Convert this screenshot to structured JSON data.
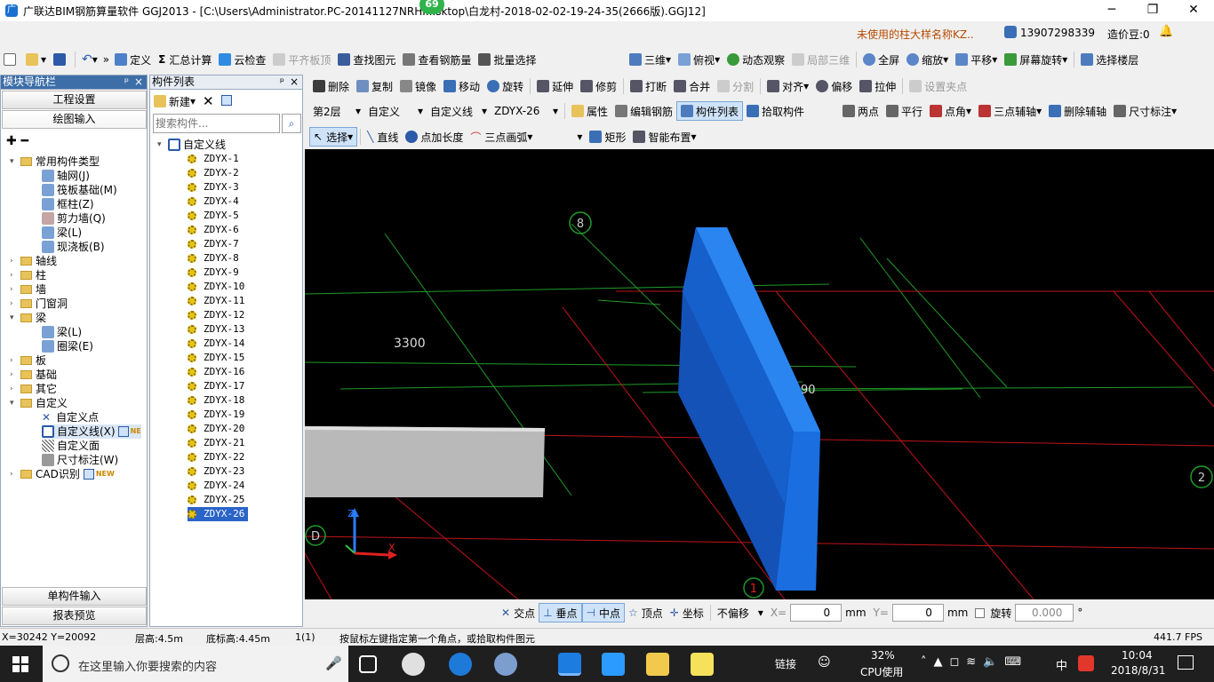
{
  "window": {
    "badge": "69",
    "title": "广联达BIM钢筋算量软件 GGJ2013 - [C:\\Users\\Administrator.PC-20141127NRHI...sktop\\白龙村-2018-02-02-19-24-35(2666版).GGJ12]",
    "min": "─",
    "max": "❐",
    "close": "✕"
  },
  "info_bar": {
    "notice": "未使用的柱大样名称KZ..",
    "phone": "13907298339",
    "beans": "造价豆:0"
  },
  "toolbar1": {
    "items": [
      "定义",
      "汇总计算",
      "云检查",
      "平齐板顶",
      "查找图元",
      "查看钢筋量",
      "批量选择",
      "三维",
      "俯视",
      "动态观察",
      "局部三维",
      "全屏",
      "缩放",
      "平移",
      "屏幕旋转",
      "选择楼层"
    ]
  },
  "toolbar2": {
    "items": [
      "删除",
      "复制",
      "镜像",
      "移动",
      "旋转",
      "延伸",
      "修剪",
      "打断",
      "合并",
      "分割",
      "对齐",
      "偏移",
      "拉伸",
      "设置夹点"
    ]
  },
  "toolbar3": {
    "floor": "第2层",
    "type": "自定义",
    "subtype": "自定义线",
    "component": "ZDYX-26",
    "items": [
      "属性",
      "编辑钢筋",
      "构件列表",
      "拾取构件",
      "两点",
      "平行",
      "点角",
      "三点辅轴",
      "删除辅轴",
      "尺寸标注"
    ]
  },
  "toolbar4": {
    "items": [
      "选择",
      "直线",
      "点加长度",
      "三点画弧",
      "矩形",
      "智能布置"
    ]
  },
  "nav_panel": {
    "title": "模块导航栏",
    "pin": "ᵖ",
    "close": "×",
    "tab_settings": "工程设置",
    "tab_drawing": "绘图输入",
    "tree": [
      "常用构件类型",
      "轴网(J)",
      "筏板基础(M)",
      "框柱(Z)",
      "剪力墙(Q)",
      "梁(L)",
      "现浇板(B)",
      "轴线",
      "柱",
      "墙",
      "门窗洞",
      "梁",
      "梁(L)",
      "圈梁(E)",
      "板",
      "基础",
      "其它",
      "自定义",
      "自定义点",
      "自定义线(X)",
      "自定义面",
      "尺寸标注(W)",
      "CAD识别"
    ],
    "new_tag": "NEW",
    "ne_tag": "NE",
    "btn_single": "单构件输入",
    "btn_report": "报表预览"
  },
  "component_panel": {
    "title": "构件列表",
    "new_label": "新建",
    "search_placeholder": "搜索构件...",
    "root": "自定义线",
    "items": [
      "ZDYX-1",
      "ZDYX-2",
      "ZDYX-3",
      "ZDYX-4",
      "ZDYX-5",
      "ZDYX-6",
      "ZDYX-7",
      "ZDYX-8",
      "ZDYX-9",
      "ZDYX-10",
      "ZDYX-11",
      "ZDYX-12",
      "ZDYX-13",
      "ZDYX-14",
      "ZDYX-15",
      "ZDYX-16",
      "ZDYX-17",
      "ZDYX-18",
      "ZDYX-19",
      "ZDYX-20",
      "ZDYX-21",
      "ZDYX-22",
      "ZDYX-23",
      "ZDYX-24",
      "ZDYX-25",
      "ZDYX-26"
    ],
    "selected": "ZDYX-26"
  },
  "viewport": {
    "axis_labels": [
      "8",
      "D",
      "1",
      "2"
    ],
    "dim_3300": "3300",
    "dim_90": "90",
    "axis_z": "Z",
    "axis_x": "X",
    "colors": {
      "bg": "#000000",
      "grid_green": "#1f9a2a",
      "grid_red": "#c0141a",
      "wall_blue": "#1670d8",
      "slab_grey": "#b9b9b9"
    }
  },
  "snap_bar": {
    "items": [
      "交点",
      "垂点",
      "中点",
      "顶点",
      "坐标"
    ],
    "offset_mode": "不偏移",
    "x_label": "X=",
    "x_value": "0",
    "y_label": "Y=",
    "y_value": "0",
    "unit": "mm",
    "rotate_label": "旋转",
    "rotate_value": "0.000",
    "degree": "°"
  },
  "status_bar": {
    "coords": "X=30242 Y=20092",
    "floor_height": "层高:4.5m",
    "base_height": "底标高:4.45m",
    "count": "1(1)",
    "hint": "按鼠标左键指定第一个角点，或拾取构件图元",
    "fps": "441.7 FPS"
  },
  "taskbar": {
    "search_placeholder": "在这里输入你要搜索的内容",
    "link": "链接",
    "cpu_pct": "32%",
    "cpu_label": "CPU使用",
    "ime": "中",
    "time": "10:04",
    "date": "2018/8/31"
  }
}
